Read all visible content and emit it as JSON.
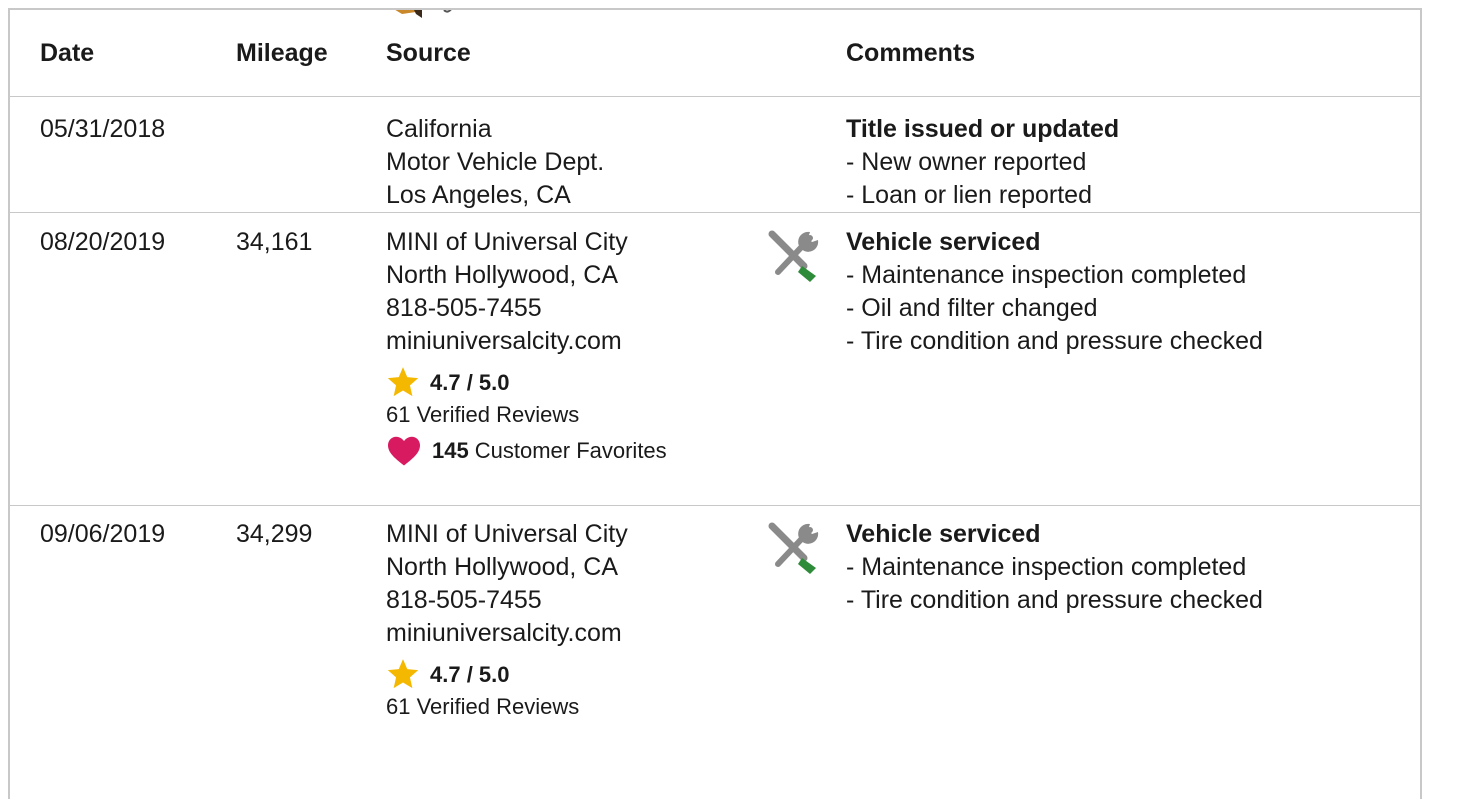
{
  "columns": {
    "date": "Date",
    "mileage": "Mileage",
    "source": "Source",
    "comments": "Comments"
  },
  "rows": [
    {
      "date": "05/31/2018",
      "mileage": "",
      "source": [
        "California",
        "Motor Vehicle Dept.",
        "Los Angeles, CA"
      ],
      "icon": "",
      "comment_title": "Title issued or updated",
      "comment_items": [
        "New owner reported",
        "Loan or lien reported"
      ]
    },
    {
      "date": "08/20/2019",
      "mileage": "34,161",
      "source": [
        "MINI of Universal City",
        "North Hollywood, CA",
        "818-505-7455",
        "miniuniversalcity.com"
      ],
      "rating": "4.7 / 5.0",
      "reviews": "61 Verified Reviews",
      "favorites_count": "145",
      "favorites_label": "Customer Favorites",
      "icon": "tools-icon",
      "comment_title": "Vehicle serviced",
      "comment_items": [
        "Maintenance inspection completed",
        "Oil and filter changed",
        "Tire condition and pressure checked"
      ]
    },
    {
      "date": "09/06/2019",
      "mileage": "34,299",
      "source": [
        "MINI of Universal City",
        "North Hollywood, CA",
        "818-505-7455",
        "miniuniversalcity.com"
      ],
      "rating": "4.7 / 5.0",
      "reviews": "61 Verified Reviews",
      "icon": "tools-icon",
      "comment_title": "Vehicle serviced",
      "comment_items": [
        "Maintenance inspection completed",
        "Tire condition and pressure checked"
      ]
    }
  ],
  "colors": {
    "star": "#f5b800",
    "heart": "#d81b60",
    "wrench_gray": "#8a8a8a",
    "screwdriver_green": "#2e8b3a",
    "border": "#c8c8c8"
  }
}
